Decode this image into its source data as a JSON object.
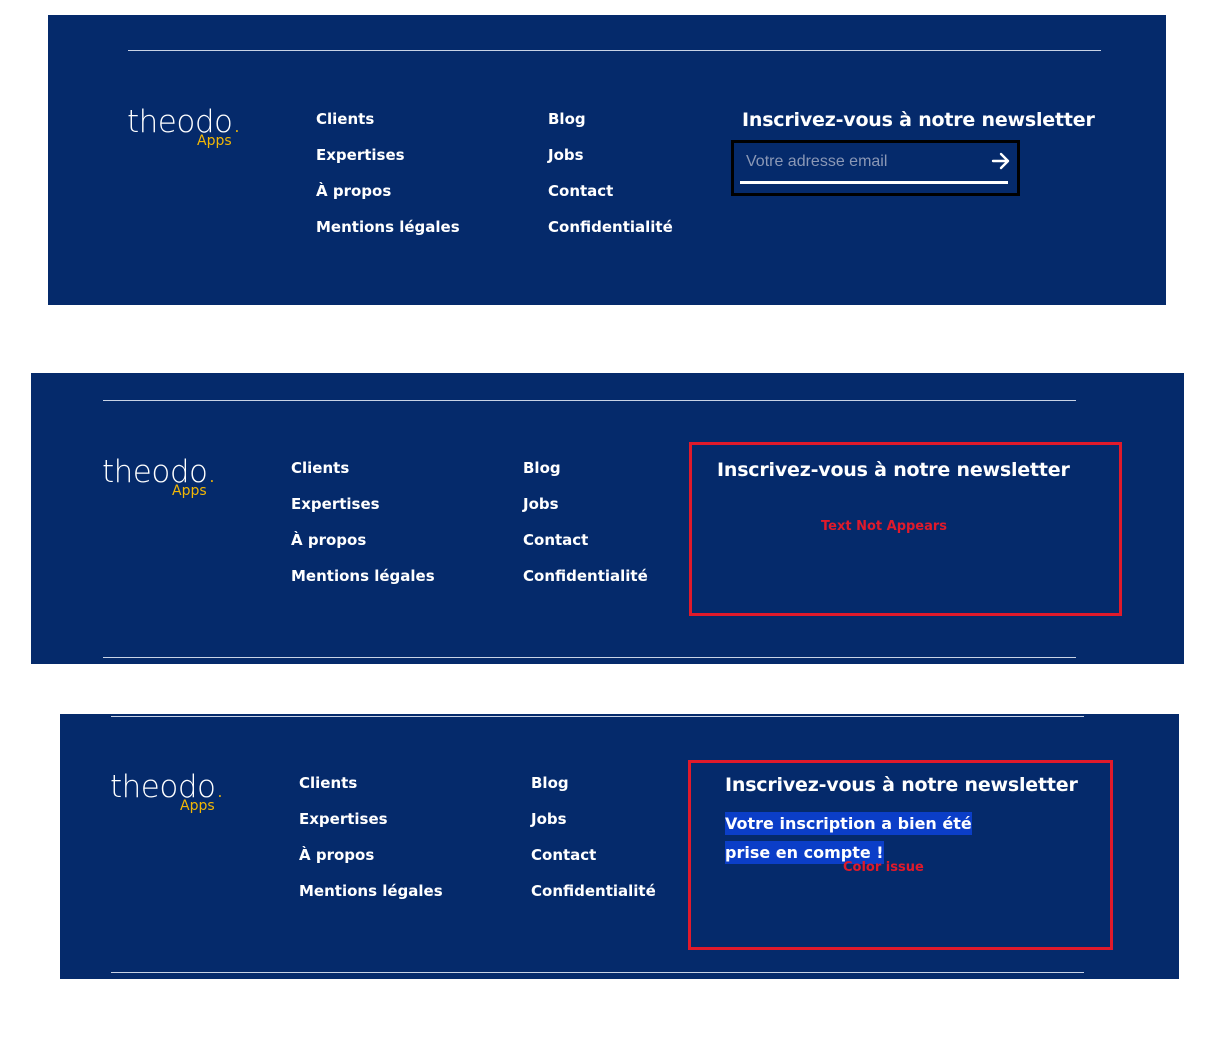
{
  "logo": {
    "word": "theodo",
    "dot": ".",
    "sub": "Apps"
  },
  "nav": {
    "col1": [
      "Clients",
      "Expertises",
      "À propos",
      "Mentions légales"
    ],
    "col2": [
      "Blog",
      "Jobs",
      "Contact",
      "Confidentialité"
    ]
  },
  "newsletter": {
    "title": "Inscrivez-vous à notre newsletter",
    "email_placeholder": "Votre adresse email",
    "success_message": "Votre inscription a bien été prise en compte !"
  },
  "annotations": {
    "text_not_appears": "Text Not Appears",
    "color_issue": "Color issue"
  },
  "colors": {
    "background": "#052a6b",
    "accent": "#f2b705",
    "annotation": "#e01a2b",
    "highlight": "#0b3ec8"
  },
  "icons": {
    "submit": "arrow-right-icon"
  }
}
